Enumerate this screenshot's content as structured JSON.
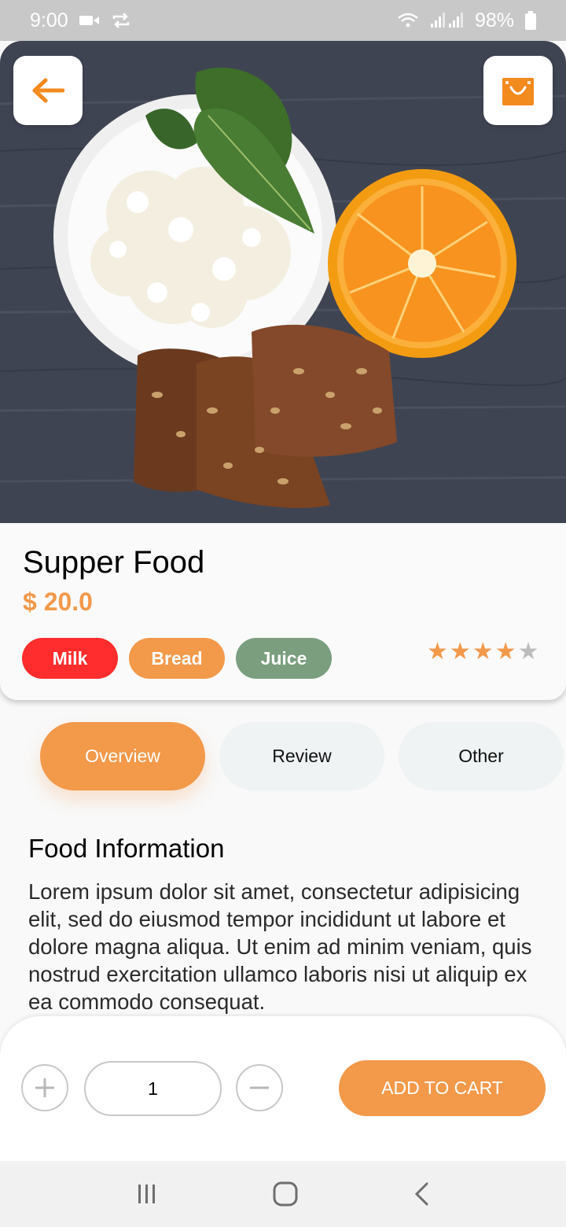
{
  "status_bar": {
    "time": "9:00",
    "battery": "98%"
  },
  "product": {
    "title": "Supper Food",
    "price": "$ 20.0",
    "tags": [
      {
        "label": "Milk",
        "color": "#ff2d2d"
      },
      {
        "label": "Bread",
        "color": "#f2994a"
      },
      {
        "label": "Juice",
        "color": "#7a9e7e"
      }
    ],
    "rating": {
      "value": 4,
      "max": 5
    }
  },
  "tabs": [
    {
      "label": "Overview",
      "active": true
    },
    {
      "label": "Review",
      "active": false
    },
    {
      "label": "Other",
      "active": false
    }
  ],
  "section": {
    "heading": "Food Information",
    "body": "Lorem ipsum dolor sit amet, consectetur adipisicing elit, sed do eiusmod tempor incididunt ut labore et dolore magna aliqua. Ut enim ad minim veniam, quis nostrud exercitation ullamco laboris nisi ut aliquip ex ea commodo consequat."
  },
  "cart": {
    "quantity": "1",
    "add_label": "ADD TO CART"
  },
  "colors": {
    "accent": "#f2994a",
    "star_inactive": "#bdbdbd"
  },
  "icons": [
    "back-arrow-icon",
    "shopping-bag-icon",
    "plus-icon",
    "minus-icon",
    "recent-apps-icon",
    "home-icon",
    "back-icon"
  ]
}
